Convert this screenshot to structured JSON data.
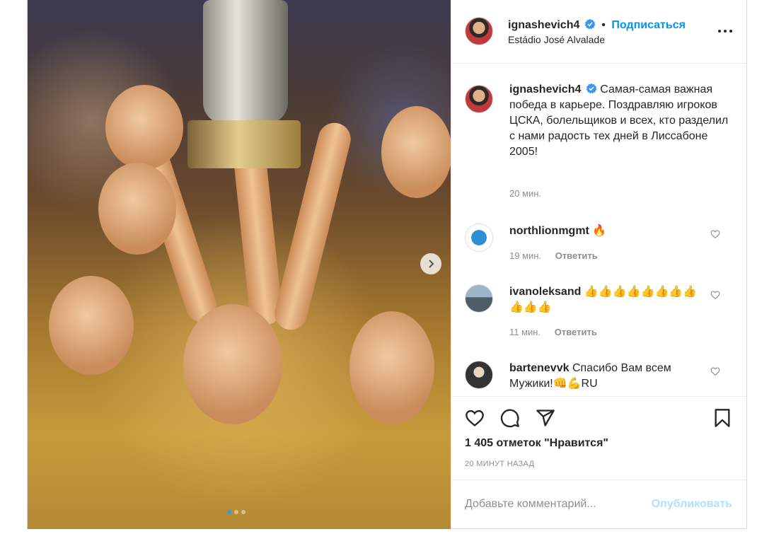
{
  "post": {
    "author": {
      "username": "ignashevich4",
      "verified_icon": "verified-badge-icon",
      "follow_label": "Подписаться",
      "separator": "•",
      "location": "Estádio José Alvalade"
    },
    "photo": {
      "next_icon": "chevron-right-icon",
      "slide_count": 3,
      "active_slide": 1
    },
    "caption": {
      "username": "ignashevich4",
      "text": "Самая-самая важная победа в карьере. Поздравляю игроков ЦСКА, болельщиков и всех, кто разделил с нами радость тех дней в Лиссабоне 2005!",
      "time": "20 мин."
    },
    "comments": [
      {
        "username": "northlionmgmt",
        "text": "🔥",
        "time": "19 мин.",
        "reply": "Ответить"
      },
      {
        "username": "ivanoleksand",
        "text": "👍👍👍👍👍👍👍👍👍👍👍",
        "time": "11 мин.",
        "reply": "Ответить"
      },
      {
        "username": "bartenevvk",
        "text": "Спасибо Вам всем Мужики!👊💪RU",
        "time": "",
        "reply": ""
      }
    ],
    "actions": {
      "like_icon": "heart-icon",
      "comment_icon": "comment-icon",
      "share_icon": "share-icon",
      "save_icon": "bookmark-icon"
    },
    "likes": "1 405 отметок \"Нравится\"",
    "posted": "20 МИНУТ НАЗАД",
    "add_comment": {
      "placeholder": "Добавьте комментарий...",
      "publish_label": "Опубликовать"
    }
  },
  "colors": {
    "accent": "#0095f6",
    "publish_disabled": "#b2dffc",
    "muted": "#8e8e8e",
    "text": "#262626",
    "border": "#dbdbdb"
  }
}
